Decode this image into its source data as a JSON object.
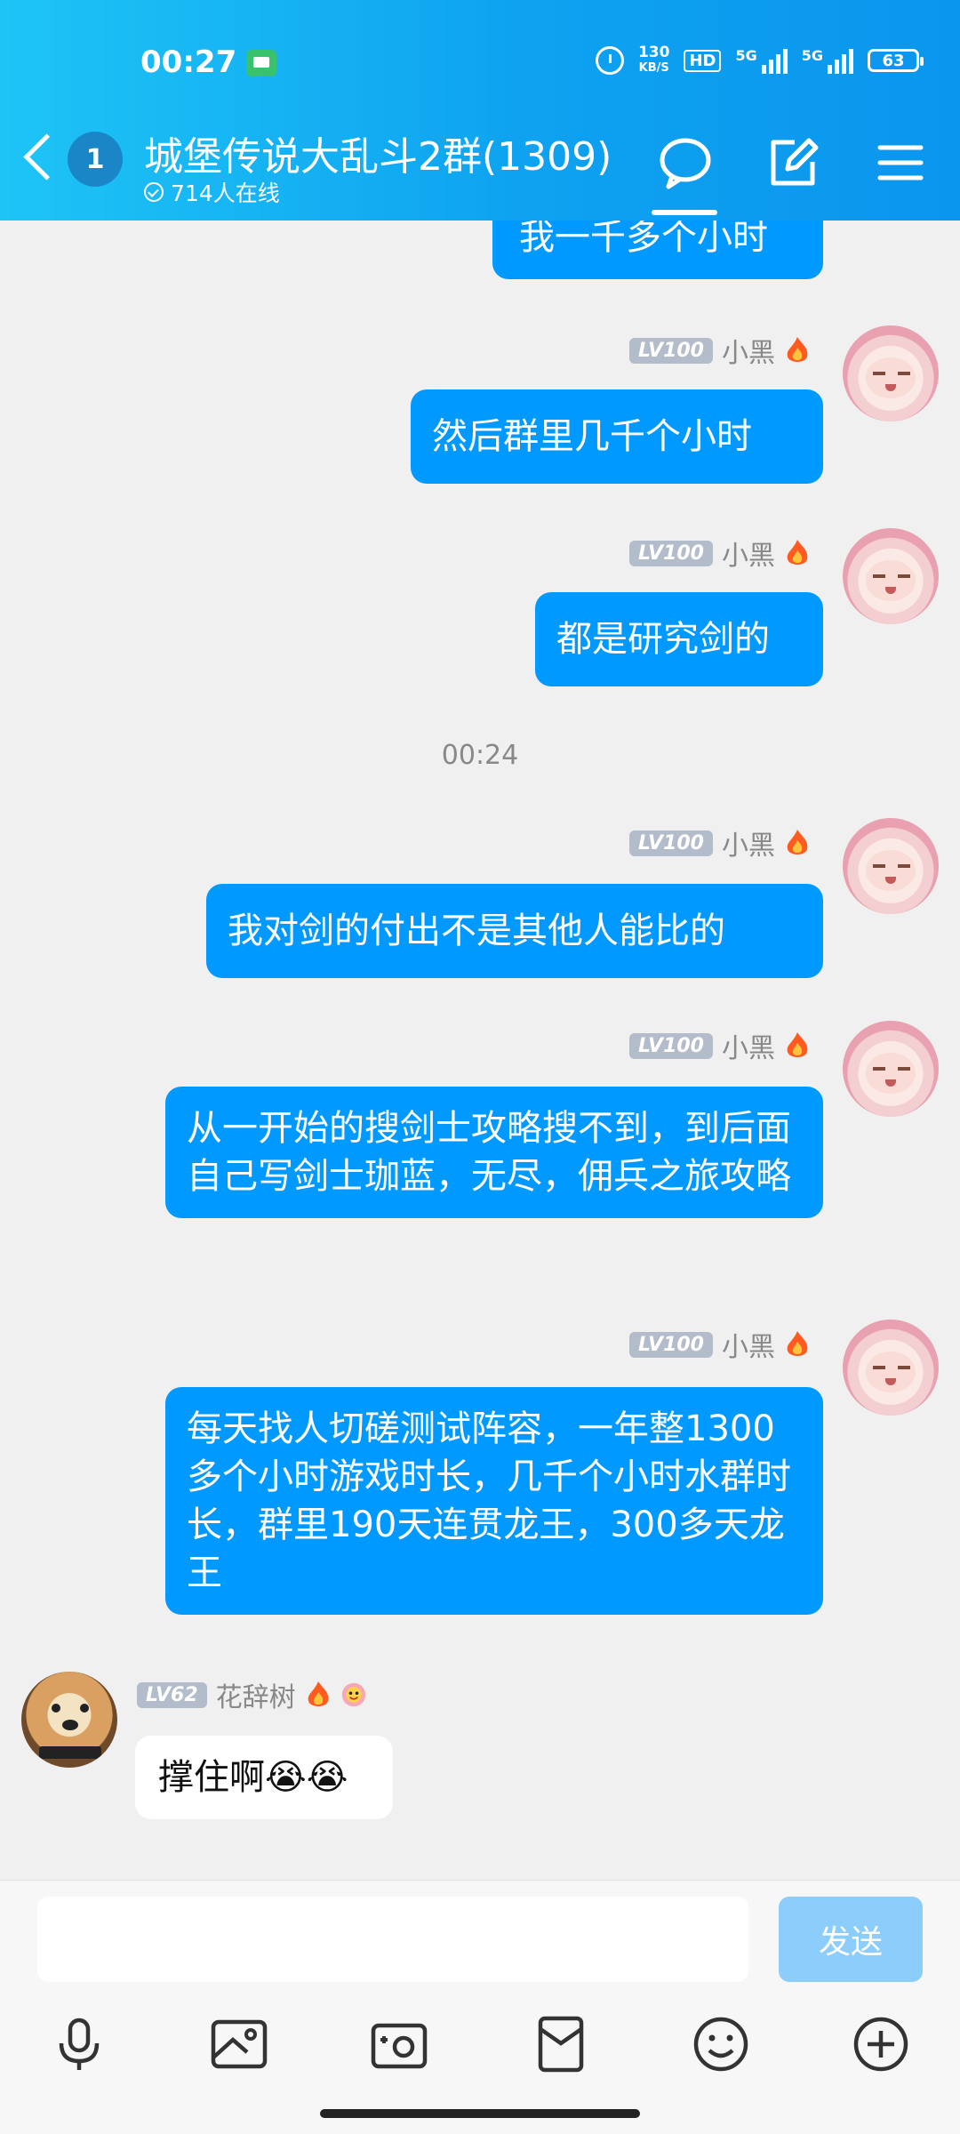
{
  "status_bar": {
    "time": "00:27",
    "net_speed_value": "130",
    "net_speed_unit": "KB/S",
    "hd": "HD",
    "signal1": "5G",
    "signal2": "5G",
    "battery": "63"
  },
  "header": {
    "unread": "1",
    "title": "城堡传说大乱斗2群(1309)",
    "online": "714人在线"
  },
  "messages": {
    "m0": {
      "text": "我一千多个小时"
    },
    "m1": {
      "level": "LV100",
      "name": "小黑",
      "text": "然后群里几千个小时"
    },
    "m2": {
      "level": "LV100",
      "name": "小黑",
      "text": "都是研究剑的"
    },
    "timestamp": "00:24",
    "m3": {
      "level": "LV100",
      "name": "小黑",
      "text": "我对剑的付出不是其他人能比的"
    },
    "m4": {
      "level": "LV100",
      "name": "小黑",
      "text": "从一开始的搜剑士攻略搜不到，到后面自己写剑士珈蓝，无尽，佣兵之旅攻略"
    },
    "m5": {
      "level": "LV100",
      "name": "小黑",
      "text": "每天找人切磋测试阵容，一年整1300多个小时游戏时长，几千个小时水群时长，群里190天连贯龙王，300多天龙王"
    },
    "m6": {
      "level": "LV62",
      "name": "花辞树",
      "text": "撑住啊😭😭"
    }
  },
  "input": {
    "placeholder": "",
    "send_label": "发送"
  },
  "colors": {
    "header_start": "#1ec4f6",
    "header_end": "#0a96ee",
    "bubble_out": "#0099ff",
    "send_disabled": "#8ccdfb"
  },
  "icons": [
    "back-icon",
    "chat-icon",
    "edit-icon",
    "menu-icon",
    "mic-icon",
    "image-icon",
    "camera-icon",
    "red-packet-icon",
    "emoji-icon",
    "plus-icon"
  ]
}
